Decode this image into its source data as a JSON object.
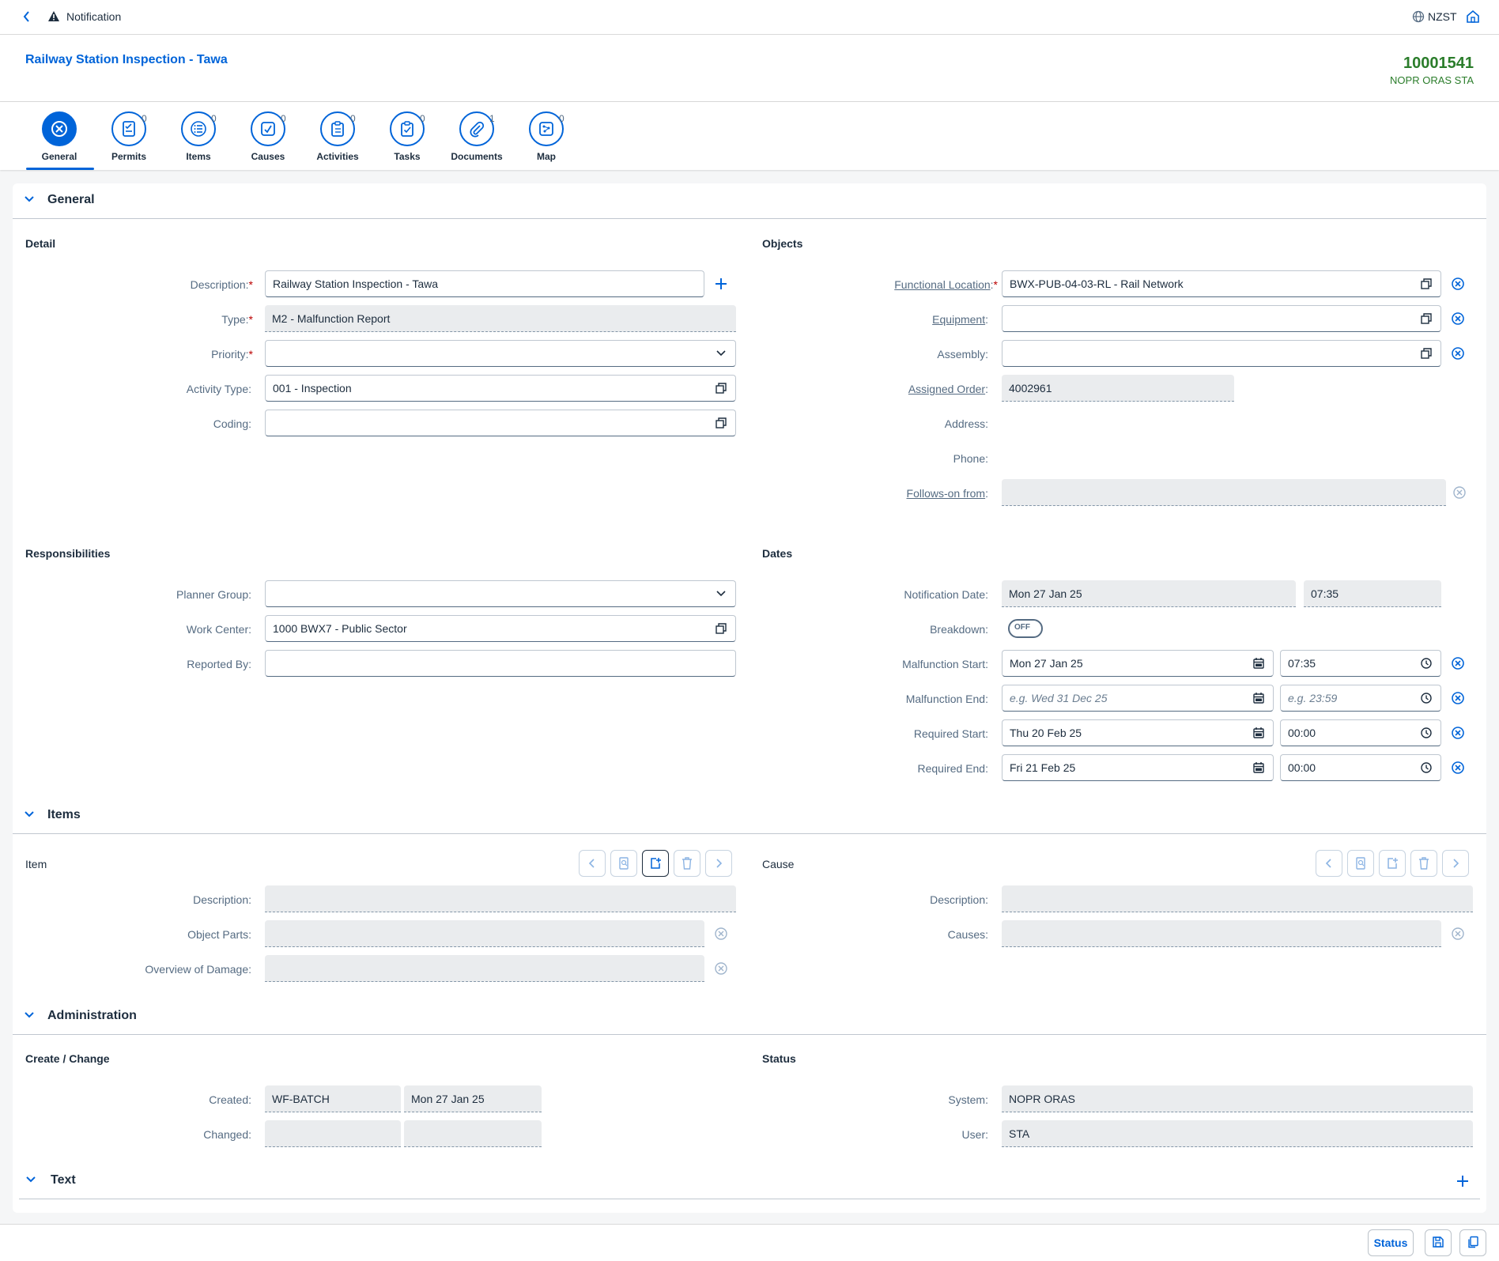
{
  "shell": {
    "app_title": "Notification",
    "timezone": "NZST"
  },
  "header": {
    "title": "Railway Station Inspection - Tawa",
    "object_number": "10001541",
    "object_status": "NOPR ORAS STA"
  },
  "tabs": [
    {
      "label": "General",
      "count": "",
      "icon": "general-icon"
    },
    {
      "label": "Permits",
      "count": "0",
      "icon": "permit-icon"
    },
    {
      "label": "Items",
      "count": "0",
      "icon": "list-icon"
    },
    {
      "label": "Causes",
      "count": "0",
      "icon": "causes-icon"
    },
    {
      "label": "Activities",
      "count": "0",
      "icon": "clipboard-icon"
    },
    {
      "label": "Tasks",
      "count": "0",
      "icon": "task-icon"
    },
    {
      "label": "Documents",
      "count": "1",
      "icon": "paperclip-icon"
    },
    {
      "label": "Map",
      "count": "0",
      "icon": "map-icon"
    }
  ],
  "general": {
    "title": "General",
    "detail": {
      "title": "Detail",
      "description": {
        "label": "Description:",
        "value": "Railway Station Inspection - Tawa"
      },
      "type": {
        "label": "Type:",
        "value": "M2 - Malfunction Report"
      },
      "priority": {
        "label": "Priority:",
        "value": ""
      },
      "activity_type": {
        "label": "Activity Type:",
        "value": "001 - Inspection"
      },
      "coding": {
        "label": "Coding:",
        "value": ""
      }
    },
    "objects": {
      "title": "Objects",
      "functional_location": {
        "label": "Functional Location",
        "value": "BWX-PUB-04-03-RL - Rail Network"
      },
      "equipment": {
        "label": "Equipment",
        "value": ""
      },
      "assembly": {
        "label": "Assembly:",
        "value": ""
      },
      "assigned_order": {
        "label": "Assigned Order",
        "value": "4002961"
      },
      "address": {
        "label": "Address:",
        "value": ""
      },
      "phone": {
        "label": "Phone:",
        "value": ""
      },
      "follows_on_from": {
        "label": "Follows-on from",
        "value": ""
      }
    },
    "responsibilities": {
      "title": "Responsibilities",
      "planner_group": {
        "label": "Planner Group:",
        "value": ""
      },
      "work_center": {
        "label": "Work Center:",
        "value": "1000 BWX7 - Public Sector"
      },
      "reported_by": {
        "label": "Reported By:",
        "value": ""
      }
    },
    "dates": {
      "title": "Dates",
      "notification_date": {
        "label": "Notification Date:",
        "date": "Mon 27 Jan 25",
        "time": "07:35"
      },
      "breakdown": {
        "label": "Breakdown:",
        "state": "OFF"
      },
      "malfunction_start": {
        "label": "Malfunction Start:",
        "date": "Mon 27 Jan 25",
        "time": "07:35"
      },
      "malfunction_end": {
        "label": "Malfunction End:",
        "date_placeholder": "e.g. Wed 31 Dec 25",
        "time_placeholder": "e.g. 23:59"
      },
      "required_start": {
        "label": "Required Start:",
        "date": "Thu 20 Feb 25",
        "time": "00:00"
      },
      "required_end": {
        "label": "Required End:",
        "date": "Fri 21 Feb 25",
        "time": "00:00"
      }
    }
  },
  "items": {
    "title": "Items",
    "item": {
      "title": "Item",
      "description": {
        "label": "Description:",
        "value": ""
      },
      "object_parts": {
        "label": "Object Parts:",
        "value": ""
      },
      "overview_of_damage": {
        "label": "Overview of Damage:",
        "value": ""
      }
    },
    "cause": {
      "title": "Cause",
      "description": {
        "label": "Description:",
        "value": ""
      },
      "causes": {
        "label": "Causes:",
        "value": ""
      }
    }
  },
  "administration": {
    "title": "Administration",
    "create_change": {
      "title": "Create / Change",
      "created": {
        "label": "Created:",
        "user": "WF-BATCH",
        "date": "Mon 27 Jan 25"
      },
      "changed": {
        "label": "Changed:",
        "user": "",
        "date": ""
      }
    },
    "status": {
      "title": "Status",
      "system": {
        "label": "System:",
        "value": "NOPR ORAS"
      },
      "user": {
        "label": "User:",
        "value": "STA"
      }
    }
  },
  "text_section": {
    "title": "Text"
  },
  "footer": {
    "status_label": "Status"
  },
  "colors": {
    "accent": "#0064d9",
    "required": "#bb0000",
    "object_number": "#2b7d2b"
  }
}
